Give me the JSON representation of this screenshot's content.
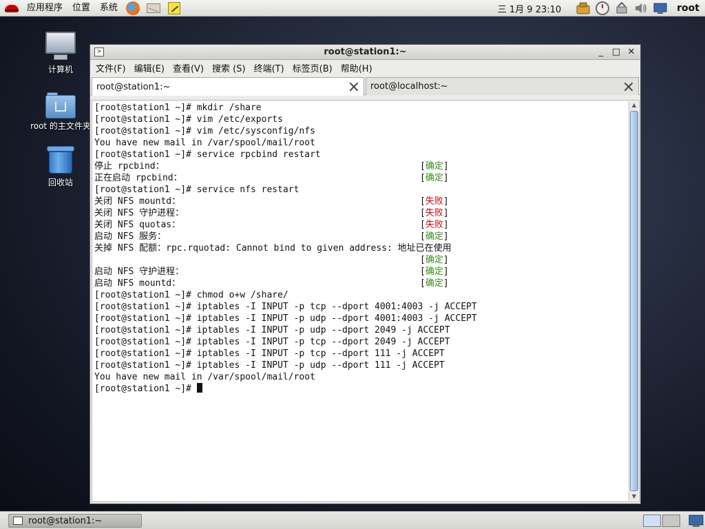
{
  "top_panel": {
    "menus": [
      "应用程序",
      "位置",
      "系统"
    ],
    "launchers": [
      "firefox-icon",
      "mail-icon",
      "notes-icon"
    ],
    "clock": "三 1月  9 23:10",
    "tray_icons": [
      "update-icon",
      "clock-icon",
      "network-icon",
      "volume-icon",
      "display-icon"
    ],
    "username": "root"
  },
  "desktop_icons": [
    {
      "label": "计算机",
      "icon": "computer-icon"
    },
    {
      "label": "root 的主文件夹",
      "icon": "home-folder-icon"
    },
    {
      "label": "回收站",
      "icon": "trash-icon"
    }
  ],
  "window": {
    "title": "root@station1:~",
    "menu": [
      "文件(F)",
      "编辑(E)",
      "查看(V)",
      "搜索 (S)",
      "终端(T)",
      "标签页(B)",
      "帮助(H)"
    ],
    "tabs": [
      {
        "label": "root@station1:~",
        "active": true
      },
      {
        "label": "root@localhost:~",
        "active": false
      }
    ],
    "terminal": {
      "lines": [
        {
          "text": "[root@station1 ~]# mkdir /share"
        },
        {
          "text": "[root@station1 ~]# vim /etc/exports"
        },
        {
          "text": "[root@station1 ~]# vim /etc/sysconfig/nfs"
        },
        {
          "text": "You have new mail in /var/spool/mail/root"
        },
        {
          "text": "[root@station1 ~]# service rpcbind restart"
        },
        {
          "text": "停止 rpcbind：",
          "status": "确定",
          "kind": "ok"
        },
        {
          "text": "正在启动 rpcbind：",
          "status": "确定",
          "kind": "ok"
        },
        {
          "text": "[root@station1 ~]# service nfs restart"
        },
        {
          "text": "关闭 NFS mountd：",
          "status": "失败",
          "kind": "fail"
        },
        {
          "text": "关闭 NFS 守护进程：",
          "status": "失败",
          "kind": "fail"
        },
        {
          "text": "关闭 NFS quotas：",
          "status": "失败",
          "kind": "fail"
        },
        {
          "text": "启动 NFS 服务：",
          "status": "确定",
          "kind": "ok"
        },
        {
          "text": "关掉 NFS 配额：rpc.rquotad: Cannot bind to given address: 地址已在使用"
        },
        {
          "text": "",
          "status": "确定",
          "kind": "ok"
        },
        {
          "text": "启动 NFS 守护进程：",
          "status": "确定",
          "kind": "ok"
        },
        {
          "text": "启动 NFS mountd：",
          "status": "确定",
          "kind": "ok"
        },
        {
          "text": "[root@station1 ~]# chmod o+w /share/"
        },
        {
          "text": "[root@station1 ~]# iptables -I INPUT -p tcp --dport 4001:4003 -j ACCEPT"
        },
        {
          "text": "[root@station1 ~]# iptables -I INPUT -p udp --dport 4001:4003 -j ACCEPT"
        },
        {
          "text": "[root@station1 ~]# iptables -I INPUT -p udp --dport 2049 -j ACCEPT"
        },
        {
          "text": "[root@station1 ~]# iptables -I INPUT -p tcp --dport 2049 -j ACCEPT"
        },
        {
          "text": "[root@station1 ~]# iptables -I INPUT -p tcp --dport 111 -j ACCEPT"
        },
        {
          "text": "[root@station1 ~]# iptables -I INPUT -p udp --dport 111 -j ACCEPT"
        },
        {
          "text": "You have new mail in /var/spool/mail/root"
        },
        {
          "text": "[root@station1 ~]# ",
          "cursor": true
        }
      ]
    }
  },
  "taskbar": {
    "items": [
      {
        "label": "root@station1:~"
      }
    ],
    "workspaces": 2,
    "active_workspace": 1
  },
  "colors": {
    "ok": "#3a8a1a",
    "fail": "#c01010",
    "panel": "#e4e4e0"
  }
}
